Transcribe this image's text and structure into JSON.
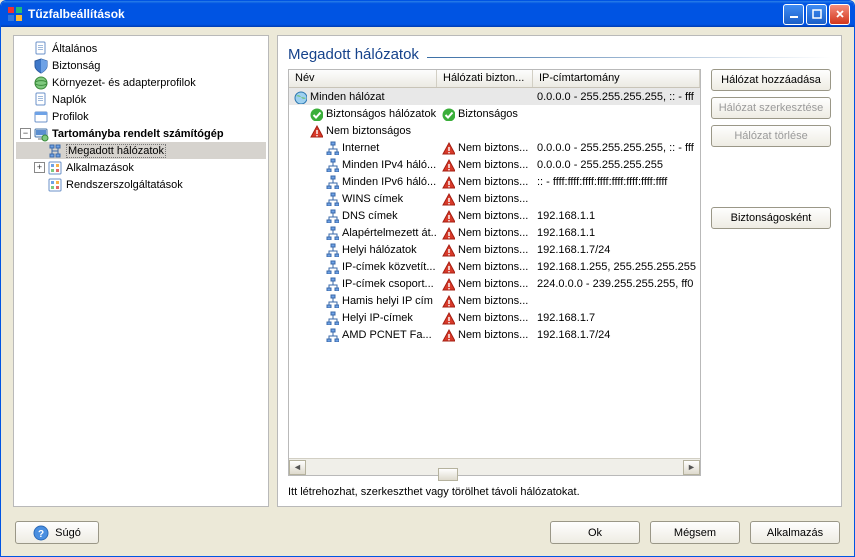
{
  "window": {
    "title": "Tűzfalbeállítások"
  },
  "tree": {
    "general": "Általános",
    "security": "Biztonság",
    "env": "Környezet- és adapterprofilok",
    "logs": "Naplók",
    "profiles": "Profilok",
    "domain_computer": "Tartományba rendelt számítógép",
    "networks": "Megadott hálózatok",
    "apps": "Alkalmazások",
    "services": "Rendszerszolgáltatások"
  },
  "panel": {
    "title": "Megadott hálózatok",
    "columns": {
      "name": "Név",
      "secure": "Hálózati bizton...",
      "range": "IP-címtartomány"
    },
    "helper": "Itt létrehozhat, szerkeszthet vagy törölhet távoli hálózatokat."
  },
  "status": {
    "secure": "Biztonságos",
    "not_secure": "Nem biztons..."
  },
  "rows": [
    {
      "indent": 0,
      "icon": "globe",
      "name": "Minden hálózat",
      "secure_icon": "",
      "secure": "",
      "range": "0.0.0.0 - 255.255.255.255, :: - fff",
      "selected": true
    },
    {
      "indent": 1,
      "icon": "check",
      "name": "Biztonságos hálózatok",
      "secure_icon": "check",
      "secure_key": "secure",
      "range": ""
    },
    {
      "indent": 1,
      "icon": "warn",
      "name": "Nem biztonságos",
      "secure_icon": "",
      "secure": "",
      "range": ""
    },
    {
      "indent": 2,
      "icon": "net",
      "name": "Internet",
      "secure_icon": "warn",
      "secure_key": "not_secure",
      "range": "0.0.0.0 - 255.255.255.255, :: - fff"
    },
    {
      "indent": 2,
      "icon": "net",
      "name": "Minden IPv4 háló...",
      "secure_icon": "warn",
      "secure_key": "not_secure",
      "range": "0.0.0.0 - 255.255.255.255"
    },
    {
      "indent": 2,
      "icon": "net",
      "name": "Minden IPv6 háló...",
      "secure_icon": "warn",
      "secure_key": "not_secure",
      "range": ":: - ffff:ffff:ffff:ffff:ffff:ffff:ffff:ffff"
    },
    {
      "indent": 2,
      "icon": "net",
      "name": "WINS címek",
      "secure_icon": "warn",
      "secure_key": "not_secure",
      "range": ""
    },
    {
      "indent": 2,
      "icon": "net",
      "name": "DNS címek",
      "secure_icon": "warn",
      "secure_key": "not_secure",
      "range": "192.168.1.1"
    },
    {
      "indent": 2,
      "icon": "net",
      "name": "Alapértelmezett át...",
      "secure_icon": "warn",
      "secure_key": "not_secure",
      "range": "192.168.1.1"
    },
    {
      "indent": 2,
      "icon": "net",
      "name": "Helyi hálózatok",
      "secure_icon": "warn",
      "secure_key": "not_secure",
      "range": "192.168.1.7/24"
    },
    {
      "indent": 2,
      "icon": "net",
      "name": "IP-címek közvetít...",
      "secure_icon": "warn",
      "secure_key": "not_secure",
      "range": "192.168.1.255, 255.255.255.255"
    },
    {
      "indent": 2,
      "icon": "net",
      "name": "IP-címek csoport...",
      "secure_icon": "warn",
      "secure_key": "not_secure",
      "range": "224.0.0.0 - 239.255.255.255, ff0"
    },
    {
      "indent": 2,
      "icon": "net",
      "name": "Hamis helyi IP cím",
      "secure_icon": "warn",
      "secure_key": "not_secure",
      "range": ""
    },
    {
      "indent": 2,
      "icon": "net",
      "name": "Helyi IP-címek",
      "secure_icon": "warn",
      "secure_key": "not_secure",
      "range": "192.168.1.7"
    },
    {
      "indent": 2,
      "icon": "net",
      "name": "AMD PCNET Fa...",
      "secure_icon": "warn",
      "secure_key": "not_secure",
      "range": "192.168.1.7/24"
    }
  ],
  "buttons": {
    "add": "Hálózat hozzáadása",
    "edit": "Hálózat szerkesztése",
    "delete": "Hálózat törlése",
    "as_secure": "Biztonságosként",
    "help": "Súgó",
    "ok": "Ok",
    "cancel": "Mégsem",
    "apply": "Alkalmazás"
  },
  "icons": {
    "app_colors": [
      "#e33",
      "#2b7",
      "#37d",
      "#fb3"
    ]
  }
}
